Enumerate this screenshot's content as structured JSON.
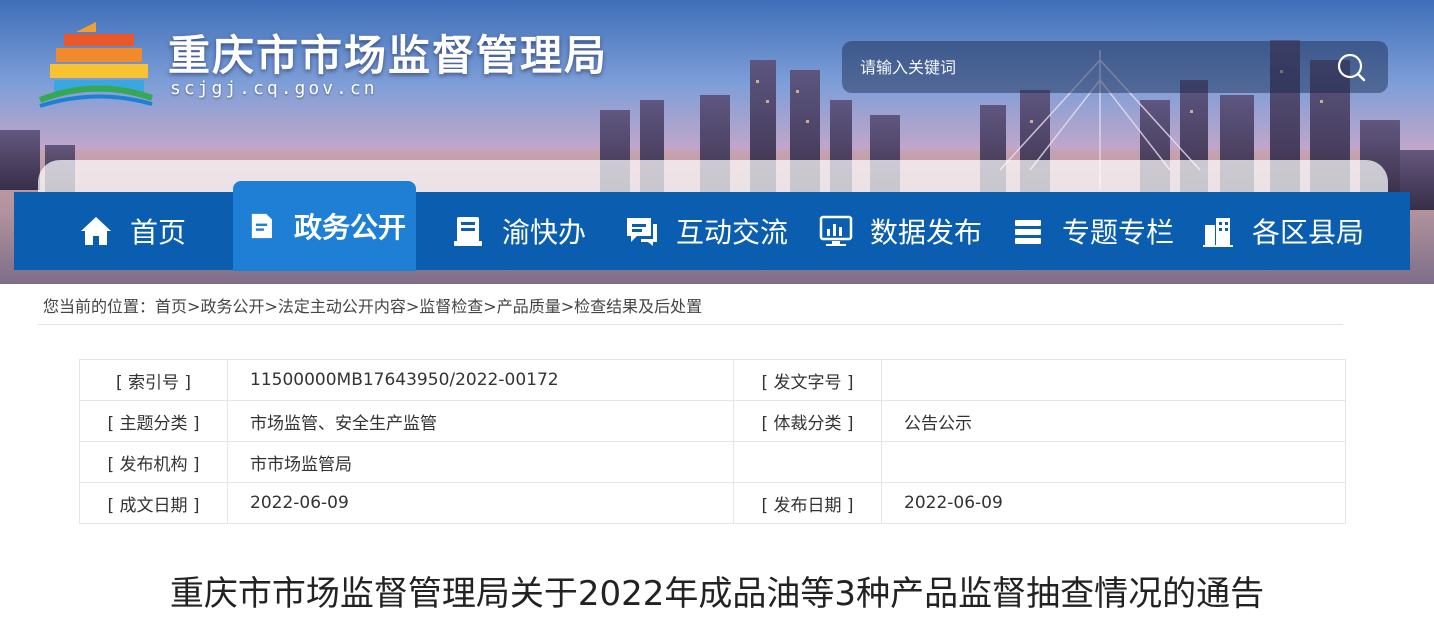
{
  "site": {
    "title": "重庆市市场监督管理局",
    "domain": "scjgj.cq.gov.cn"
  },
  "search": {
    "placeholder": "请输入关键词"
  },
  "nav": {
    "items": [
      {
        "label": "首页",
        "icon": "home-icon"
      },
      {
        "label": "政务公开",
        "icon": "document-icon",
        "active": true
      },
      {
        "label": "渝快办",
        "icon": "service-icon"
      },
      {
        "label": "互动交流",
        "icon": "chat-icon"
      },
      {
        "label": "数据发布",
        "icon": "data-chart-icon"
      },
      {
        "label": "专题专栏",
        "icon": "stack-icon"
      },
      {
        "label": "各区县局",
        "icon": "building-icon"
      }
    ],
    "colors": {
      "bar": "#0b5eaf",
      "active": "#1e7fd4"
    }
  },
  "breadcrumb": {
    "prefix": "您当前的位置：",
    "items": [
      "首页",
      "政务公开",
      "法定主动公开内容",
      "监督检查",
      "产品质量",
      "检查结果及后处置"
    ],
    "separator": ">"
  },
  "info": {
    "rows": [
      {
        "l1": "[ 索引号 ]",
        "v1": "11500000MB17643950/2022-00172",
        "l2": "[ 发文字号 ]",
        "v2": ""
      },
      {
        "l1": "[ 主题分类 ]",
        "v1": "市场监管、安全生产监管",
        "l2": "[ 体裁分类 ]",
        "v2": "公告公示"
      },
      {
        "l1": "[ 发布机构 ]",
        "v1": "市市场监管局",
        "l2": "",
        "v2": ""
      },
      {
        "l1": "[ 成文日期 ]",
        "v1": "2022-06-09",
        "l2": "[ 发布日期 ]",
        "v2": "2022-06-09"
      }
    ]
  },
  "article": {
    "title": "重庆市市场监督管理局关于2022年成品油等3种产品监督抽查情况的通告"
  }
}
